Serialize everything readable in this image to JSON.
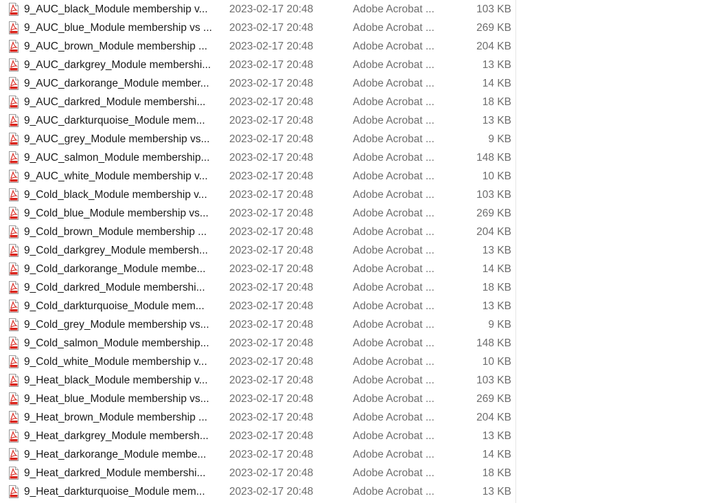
{
  "file_list": {
    "icon": "pdf-file-icon",
    "colors": {
      "icon_red": "#d9241c",
      "name_text": "#1a1a1a",
      "meta_text": "#6d6d6d"
    },
    "rows": [
      {
        "name": "9_AUC_black_Module membership v...",
        "date": "2023-02-17 20:48",
        "type": "Adobe Acrobat ...",
        "size": "103 KB"
      },
      {
        "name": "9_AUC_blue_Module membership vs ...",
        "date": "2023-02-17 20:48",
        "type": "Adobe Acrobat ...",
        "size": "269 KB"
      },
      {
        "name": "9_AUC_brown_Module membership ...",
        "date": "2023-02-17 20:48",
        "type": "Adobe Acrobat ...",
        "size": "204 KB"
      },
      {
        "name": "9_AUC_darkgrey_Module membershi...",
        "date": "2023-02-17 20:48",
        "type": "Adobe Acrobat ...",
        "size": "13 KB"
      },
      {
        "name": "9_AUC_darkorange_Module member...",
        "date": "2023-02-17 20:48",
        "type": "Adobe Acrobat ...",
        "size": "14 KB"
      },
      {
        "name": "9_AUC_darkred_Module membershi...",
        "date": "2023-02-17 20:48",
        "type": "Adobe Acrobat ...",
        "size": "18 KB"
      },
      {
        "name": "9_AUC_darkturquoise_Module mem...",
        "date": "2023-02-17 20:48",
        "type": "Adobe Acrobat ...",
        "size": "13 KB"
      },
      {
        "name": "9_AUC_grey_Module membership vs...",
        "date": "2023-02-17 20:48",
        "type": "Adobe Acrobat ...",
        "size": "9 KB"
      },
      {
        "name": "9_AUC_salmon_Module membership...",
        "date": "2023-02-17 20:48",
        "type": "Adobe Acrobat ...",
        "size": "148 KB"
      },
      {
        "name": "9_AUC_white_Module membership v...",
        "date": "2023-02-17 20:48",
        "type": "Adobe Acrobat ...",
        "size": "10 KB"
      },
      {
        "name": "9_Cold_black_Module membership v...",
        "date": "2023-02-17 20:48",
        "type": "Adobe Acrobat ...",
        "size": "103 KB"
      },
      {
        "name": "9_Cold_blue_Module membership vs...",
        "date": "2023-02-17 20:48",
        "type": "Adobe Acrobat ...",
        "size": "269 KB"
      },
      {
        "name": "9_Cold_brown_Module membership ...",
        "date": "2023-02-17 20:48",
        "type": "Adobe Acrobat ...",
        "size": "204 KB"
      },
      {
        "name": "9_Cold_darkgrey_Module membersh...",
        "date": "2023-02-17 20:48",
        "type": "Adobe Acrobat ...",
        "size": "13 KB"
      },
      {
        "name": "9_Cold_darkorange_Module membe...",
        "date": "2023-02-17 20:48",
        "type": "Adobe Acrobat ...",
        "size": "14 KB"
      },
      {
        "name": "9_Cold_darkred_Module membershi...",
        "date": "2023-02-17 20:48",
        "type": "Adobe Acrobat ...",
        "size": "18 KB"
      },
      {
        "name": "9_Cold_darkturquoise_Module mem...",
        "date": "2023-02-17 20:48",
        "type": "Adobe Acrobat ...",
        "size": "13 KB"
      },
      {
        "name": "9_Cold_grey_Module membership vs...",
        "date": "2023-02-17 20:48",
        "type": "Adobe Acrobat ...",
        "size": "9 KB"
      },
      {
        "name": "9_Cold_salmon_Module membership...",
        "date": "2023-02-17 20:48",
        "type": "Adobe Acrobat ...",
        "size": "148 KB"
      },
      {
        "name": "9_Cold_white_Module membership v...",
        "date": "2023-02-17 20:48",
        "type": "Adobe Acrobat ...",
        "size": "10 KB"
      },
      {
        "name": "9_Heat_black_Module membership v...",
        "date": "2023-02-17 20:48",
        "type": "Adobe Acrobat ...",
        "size": "103 KB"
      },
      {
        "name": "9_Heat_blue_Module membership vs...",
        "date": "2023-02-17 20:48",
        "type": "Adobe Acrobat ...",
        "size": "269 KB"
      },
      {
        "name": "9_Heat_brown_Module membership ...",
        "date": "2023-02-17 20:48",
        "type": "Adobe Acrobat ...",
        "size": "204 KB"
      },
      {
        "name": "9_Heat_darkgrey_Module membersh...",
        "date": "2023-02-17 20:48",
        "type": "Adobe Acrobat ...",
        "size": "13 KB"
      },
      {
        "name": "9_Heat_darkorange_Module membe...",
        "date": "2023-02-17 20:48",
        "type": "Adobe Acrobat ...",
        "size": "14 KB"
      },
      {
        "name": "9_Heat_darkred_Module membershi...",
        "date": "2023-02-17 20:48",
        "type": "Adobe Acrobat ...",
        "size": "18 KB"
      },
      {
        "name": "9_Heat_darkturquoise_Module mem...",
        "date": "2023-02-17 20:48",
        "type": "Adobe Acrobat ...",
        "size": "13 KB"
      }
    ]
  }
}
